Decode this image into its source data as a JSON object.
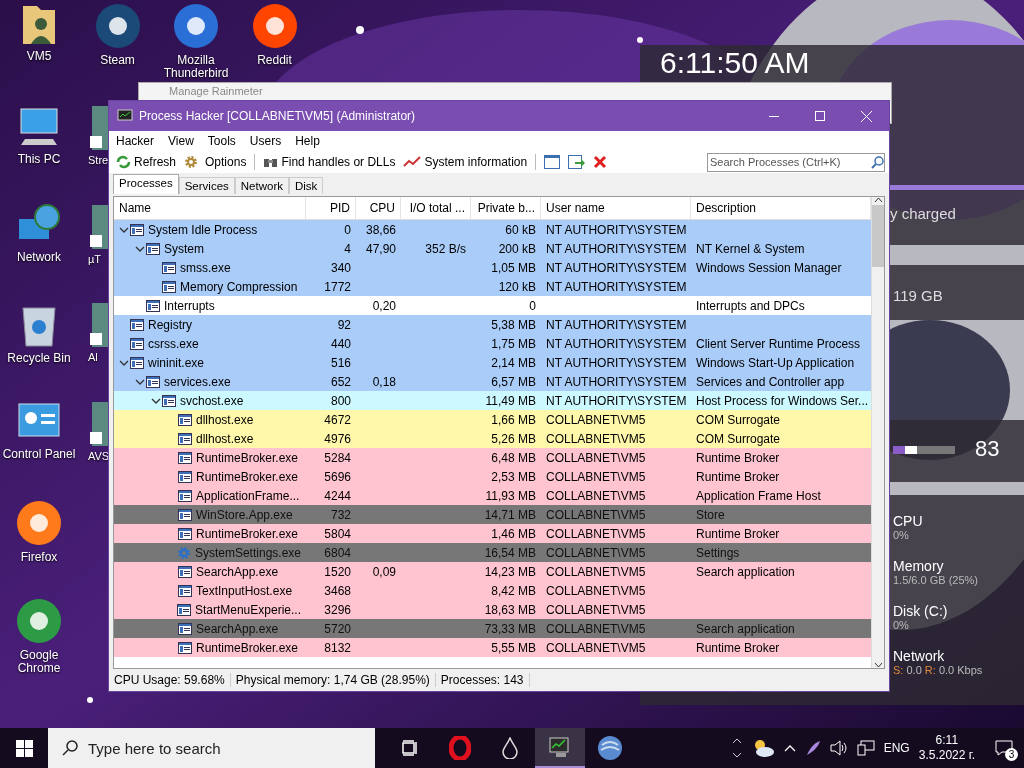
{
  "desktop_icons": [
    {
      "label": "VM5",
      "kind": "folder",
      "color": "#e8c77a"
    },
    {
      "label": "Steam",
      "kind": "round",
      "color": "#1b4a78"
    },
    {
      "label": "Mozilla Thunderbird",
      "kind": "round",
      "color": "#2a6fd6"
    },
    {
      "label": "Reddit",
      "kind": "round",
      "color": "#ff4500"
    },
    {
      "label": "This PC",
      "kind": "monitor",
      "color": "#3aa0e8"
    },
    {
      "label": "Network",
      "kind": "globe",
      "color": "#2f8fd8"
    },
    {
      "label": "Recycle Bin",
      "kind": "bin",
      "color": "#c8d4e0"
    },
    {
      "label": "Control Panel",
      "kind": "panel",
      "color": "#3b9be0"
    },
    {
      "label": "Firefox",
      "kind": "round",
      "color": "#ff7a1a"
    },
    {
      "label": "Google Chrome",
      "kind": "round",
      "color": "#2d9b45"
    }
  ],
  "partial_icons": [
    {
      "label": "Stre"
    },
    {
      "label": "µT"
    },
    {
      "label": "Al"
    },
    {
      "label": "AVS"
    }
  ],
  "rainmeter": {
    "clock": "6:11:50 AM",
    "battery": "y charged",
    "storage": "119 GB",
    "volume": {
      "reading": "83"
    },
    "stats": [
      {
        "label": "CPU",
        "value": "0%"
      },
      {
        "label": "Memory",
        "value": "1.5/6.0 GB (25%)"
      },
      {
        "label": "Disk (C:)",
        "value": "0%"
      }
    ],
    "network": {
      "label": "Network",
      "send_label": "S:",
      "send": "0.0",
      "receive_label": "R:",
      "receive": "0.0 Kbps"
    }
  },
  "background_window": {
    "title": "Manage Rainmeter"
  },
  "window": {
    "title": "Process Hacker [COLLABNET\\VM5] (Administrator)",
    "menu": [
      "Hacker",
      "View",
      "Tools",
      "Users",
      "Help"
    ],
    "toolbar": [
      {
        "label": "Refresh",
        "kind": "refresh"
      },
      {
        "label": "Options",
        "kind": "options"
      },
      {
        "kind": "separator"
      },
      {
        "label": "Find handles or DLLs",
        "kind": "find"
      },
      {
        "label": "System information",
        "kind": "sysinfo"
      },
      {
        "kind": "separator"
      },
      {
        "kind": "window"
      },
      {
        "kind": "window-go"
      },
      {
        "kind": "terminate"
      }
    ],
    "search": {
      "placeholder": "Search Processes (Ctrl+K)"
    },
    "tabs": [
      {
        "label": "Processes",
        "selected": true
      },
      {
        "label": "Services",
        "selected": false
      },
      {
        "label": "Network",
        "selected": false
      },
      {
        "label": "Disk",
        "selected": false
      }
    ],
    "table": {
      "columns": [
        "Name",
        "PID",
        "CPU",
        "I/O total ...",
        "Private b...",
        "User name",
        "Description"
      ],
      "rows": [
        {
          "name": "System Idle Process",
          "pid": "0",
          "cpu": "38,66",
          "private": "60 kB",
          "user": "NT AUTHORITY\\SYSTEM",
          "color": "#aaccf8",
          "kind": "app",
          "expanded": true,
          "children": [
            {
              "name": "System",
              "pid": "4",
              "cpu": "47,90",
              "io": "352 B/s",
              "private": "200 kB",
              "user": "NT AUTHORITY\\SYSTEM",
              "description": "NT Kernel & System",
              "color": "#aaccf8",
              "kind": "app",
              "expanded": true,
              "children": [
                {
                  "name": "smss.exe",
                  "pid": "340",
                  "private": "1,05 MB",
                  "user": "NT AUTHORITY\\SYSTEM",
                  "description": "Windows Session Manager",
                  "color": "#aaccf8",
                  "kind": "app"
                },
                {
                  "name": "Memory Compression",
                  "pid": "1772",
                  "private": "120 kB",
                  "user": "NT AUTHORITY\\SYSTEM",
                  "color": "#aaccf8",
                  "kind": "app"
                }
              ]
            },
            {
              "name": "Interrupts",
              "cpu": "0,20",
              "private": "0",
              "description": "Interrupts and DPCs",
              "color": "#ffffff",
              "kind": "app"
            }
          ]
        },
        {
          "name": "Registry",
          "pid": "92",
          "private": "5,38 MB",
          "user": "NT AUTHORITY\\SYSTEM",
          "color": "#aaccf8",
          "kind": "app"
        },
        {
          "name": "csrss.exe",
          "pid": "440",
          "private": "1,75 MB",
          "user": "NT AUTHORITY\\SYSTEM",
          "description": "Client Server Runtime Process",
          "color": "#aaccf8",
          "kind": "app"
        },
        {
          "name": "wininit.exe",
          "pid": "516",
          "private": "2,14 MB",
          "user": "NT AUTHORITY\\SYSTEM",
          "description": "Windows Start-Up Application",
          "color": "#aaccf8",
          "kind": "app",
          "expanded": true,
          "children": [
            {
              "name": "services.exe",
              "pid": "652",
              "cpu": "0,18",
              "private": "6,57 MB",
              "user": "NT AUTHORITY\\SYSTEM",
              "description": "Services and Controller app",
              "color": "#aaccf8",
              "kind": "app",
              "expanded": true,
              "children": [
                {
                  "name": "svchost.exe",
                  "pid": "800",
                  "private": "11,49 MB",
                  "user": "NT AUTHORITY\\SYSTEM",
                  "description": "Host Process for Windows Ser...",
                  "color": "#ccf8ff",
                  "kind": "app",
                  "expanded": true,
                  "children": [
                    {
                      "name": "dllhost.exe",
                      "pid": "4672",
                      "private": "1,66 MB",
                      "user": "COLLABNET\\VM5",
                      "description": "COM Surrogate",
                      "color": "#fff8aa",
                      "kind": "app"
                    },
                    {
                      "name": "dllhost.exe",
                      "pid": "4976",
                      "private": "5,26 MB",
                      "user": "COLLABNET\\VM5",
                      "description": "COM Surrogate",
                      "color": "#fff8aa",
                      "kind": "app"
                    },
                    {
                      "name": "RuntimeBroker.exe",
                      "pid": "5284",
                      "private": "6,48 MB",
                      "user": "COLLABNET\\VM5",
                      "description": "Runtime Broker",
                      "color": "#ffc4d0",
                      "kind": "app"
                    },
                    {
                      "name": "RuntimeBroker.exe",
                      "pid": "5696",
                      "private": "2,53 MB",
                      "user": "COLLABNET\\VM5",
                      "description": "Runtime Broker",
                      "color": "#ffc4d0",
                      "kind": "app"
                    },
                    {
                      "name": "ApplicationFrame...",
                      "pid": "4244",
                      "private": "11,93 MB",
                      "user": "COLLABNET\\VM5",
                      "description": "Application Frame Host",
                      "color": "#ffc4d0",
                      "kind": "app"
                    },
                    {
                      "name": "WinStore.App.exe",
                      "pid": "732",
                      "private": "14,71 MB",
                      "user": "COLLABNET\\VM5",
                      "description": "Store",
                      "color": "#777777",
                      "kind": "app"
                    },
                    {
                      "name": "RuntimeBroker.exe",
                      "pid": "5804",
                      "private": "1,46 MB",
                      "user": "COLLABNET\\VM5",
                      "description": "Runtime Broker",
                      "color": "#ffc4d0",
                      "kind": "app"
                    },
                    {
                      "name": "SystemSettings.exe",
                      "pid": "6804",
                      "private": "16,54 MB",
                      "user": "COLLABNET\\VM5",
                      "description": "Settings",
                      "color": "#777777",
                      "kind": "gear"
                    },
                    {
                      "name": "SearchApp.exe",
                      "pid": "1520",
                      "cpu": "0,09",
                      "private": "14,23 MB",
                      "user": "COLLABNET\\VM5",
                      "description": "Search application",
                      "color": "#ffc4d0",
                      "kind": "app"
                    },
                    {
                      "name": "TextInputHost.exe",
                      "pid": "3468",
                      "private": "8,42 MB",
                      "user": "COLLABNET\\VM5",
                      "color": "#ffc4d0",
                      "kind": "app"
                    },
                    {
                      "name": "StartMenuExperie...",
                      "pid": "3296",
                      "private": "18,63 MB",
                      "user": "COLLABNET\\VM5",
                      "color": "#ffc4d0",
                      "kind": "app"
                    },
                    {
                      "name": "SearchApp.exe",
                      "pid": "5720",
                      "private": "73,33 MB",
                      "user": "COLLABNET\\VM5",
                      "description": "Search application",
                      "color": "#777777",
                      "kind": "app"
                    },
                    {
                      "name": "RuntimeBroker.exe",
                      "pid": "8132",
                      "private": "5,55 MB",
                      "user": "COLLABNET\\VM5",
                      "description": "Runtime Broker",
                      "color": "#ffc4d0",
                      "kind": "app"
                    }
                  ]
                }
              ]
            }
          ]
        }
      ]
    },
    "status_bar": [
      "CPU Usage: 59.68%",
      "Physical memory: 1,74 GB (28.95%)",
      "Processes: 143"
    ]
  },
  "taskbar": {
    "search": {
      "placeholder": "Type here to search"
    },
    "apps": [
      {
        "kind": "taskview",
        "active": false
      },
      {
        "kind": "opera",
        "active": false
      },
      {
        "kind": "drop",
        "active": false
      },
      {
        "kind": "monitor",
        "active": true
      },
      {
        "kind": "shell",
        "active": false
      }
    ],
    "language": "ENG",
    "time": "6:11",
    "date": "3.5.2022 г.",
    "notifications": "3"
  }
}
